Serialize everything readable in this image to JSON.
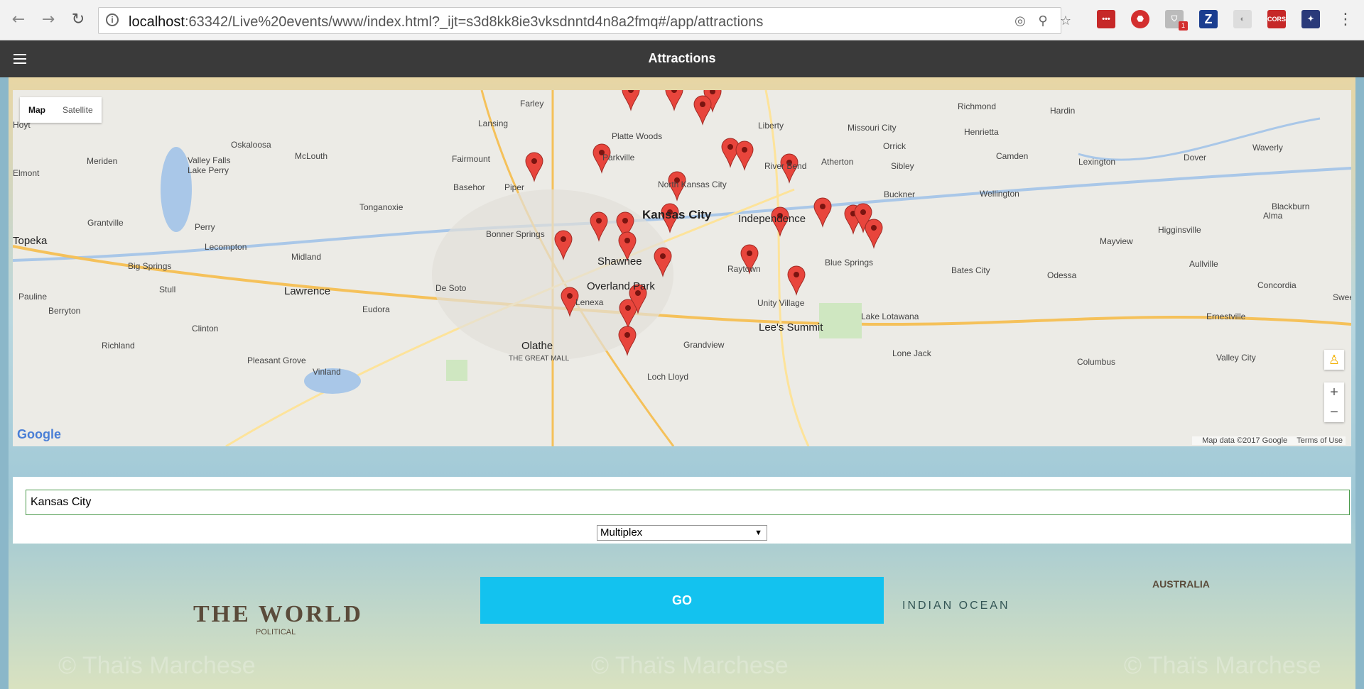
{
  "browser": {
    "url_host": "localhost",
    "url_rest": ":63342/Live%20events/www/index.html?_ijt=s3d8kk8ie3vksdnntd4n8a2fmq#/app/attractions",
    "extension_badge": "1",
    "extension_cors": "CORS",
    "extension_z": "Z"
  },
  "appbar": {
    "title": "Attractions"
  },
  "map": {
    "type_buttons": [
      "Map",
      "Satellite"
    ],
    "zoom_in": "+",
    "zoom_out": "−",
    "logo": "Google",
    "attribution": "Map data ©2017 Google",
    "terms": "Terms of Use",
    "places": [
      "Farley",
      "Richmond",
      "Hardin",
      "Lansing",
      "Platte Woods",
      "Liberty",
      "Missouri City",
      "Henrietta",
      "Oskaloosa",
      "McLouth",
      "Hoyt",
      "Meriden",
      "Valley Falls",
      "Lake Perry",
      "Parkville",
      "River Bend",
      "Atherton",
      "Orrick",
      "Camden",
      "Lexington",
      "Dover",
      "Waverly",
      "Fairmount",
      "Basehor",
      "Piper",
      "North Kansas City",
      "Sibley",
      "Buckner",
      "Wellington",
      "Kansas City",
      "Independence",
      "Tonganoxie",
      "Topeka",
      "Grantville",
      "Perry",
      "Bonner Springs",
      "Blackburn",
      "Higginsville",
      "Alma",
      "Shawnee",
      "Blue Springs",
      "Lecompton",
      "Midland",
      "Mayview",
      "Big Springs",
      "Bates City",
      "Odessa",
      "Aullville",
      "Raytown",
      "Overland Park",
      "De Soto",
      "Concordia",
      "Lawrence",
      "Stull",
      "Lenexa",
      "Eudora",
      "Pauline",
      "Unity Village",
      "Berryton",
      "Lake Lotawana",
      "Ernestville",
      "Clinton",
      "Lee's Summit",
      "Richland",
      "Olathe",
      "Grandview",
      "Lone Jack",
      "Pleasant Grove",
      "Vinland",
      "Columbus",
      "Valley City",
      "Loch Lloyd",
      "THE GREAT MALL",
      "Elmont",
      "Sweet"
    ]
  },
  "form": {
    "city_value": "Kansas City",
    "category_selected": "Multiplex",
    "go_label": "GO"
  },
  "background": {
    "title": "THE WORLD",
    "subtitle": "POLITICAL",
    "ocean_label": "INDIAN OCEAN",
    "continent_label": "AUSTRALIA",
    "watermark": "© Thaïs Marchese"
  },
  "colors": {
    "appbar": "#3a3a3a",
    "go_button": "#13c2ef",
    "marker": "#e8453c"
  }
}
